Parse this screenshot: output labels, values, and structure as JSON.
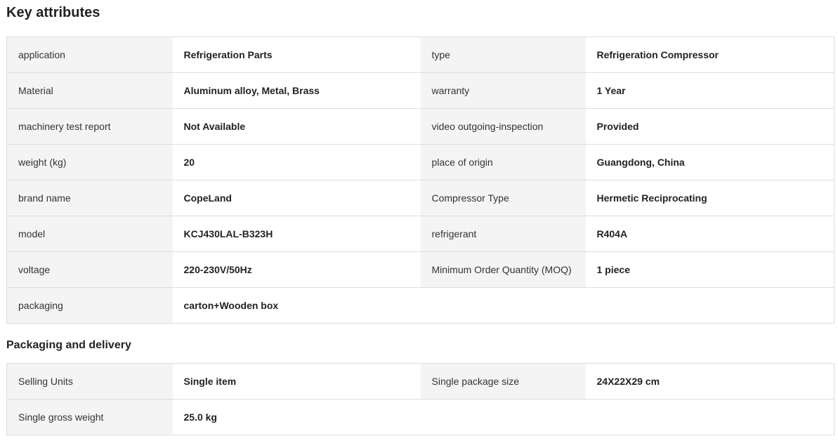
{
  "key_attributes": {
    "title": "Key attributes",
    "rows": [
      {
        "l1": "application",
        "v1": "Refrigeration Parts",
        "l2": "type",
        "v2": "Refrigeration Compressor"
      },
      {
        "l1": "Material",
        "v1": "Aluminum alloy, Metal, Brass",
        "l2": "warranty",
        "v2": "1 Year"
      },
      {
        "l1": "machinery test report",
        "v1": "Not Available",
        "l2": "video outgoing-inspection",
        "v2": "Provided"
      },
      {
        "l1": "weight (kg)",
        "v1": "20",
        "l2": "place of origin",
        "v2": "Guangdong, China"
      },
      {
        "l1": "brand name",
        "v1": "CopeLand",
        "l2": "Compressor Type",
        "v2": "Hermetic Reciprocating"
      },
      {
        "l1": "model",
        "v1": "KCJ430LAL-B323H",
        "l2": "refrigerant",
        "v2": "R404A"
      },
      {
        "l1": "voltage",
        "v1": "220-230V/50Hz",
        "l2": "Minimum Order Quantity (MOQ)",
        "v2": "1 piece"
      },
      {
        "l1": "packaging",
        "v1": "carton+Wooden box"
      }
    ]
  },
  "packaging_delivery": {
    "title": "Packaging and delivery",
    "rows": [
      {
        "l1": "Selling Units",
        "v1": "Single item",
        "l2": "Single package size",
        "v2": "24X22X29 cm"
      },
      {
        "l1": "Single gross weight",
        "v1": "25.0 kg"
      }
    ]
  }
}
